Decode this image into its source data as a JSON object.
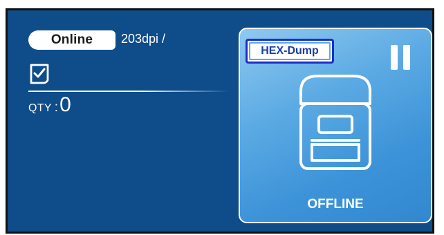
{
  "status": {
    "connection": "Online",
    "resolution": "203dpi /"
  },
  "quantity": {
    "label": "QTY",
    "separator": ":",
    "value": "0"
  },
  "printer_card": {
    "mode_badge": "HEX-Dump",
    "state": "OFFLINE",
    "pause_icon": "pause-icon",
    "printer_icon": "printer-icon"
  },
  "colors": {
    "screen_background": "#0f4c8a",
    "card_gradient_start": "#8fc9ef",
    "card_gradient_end": "#3288cf",
    "badge_border": "#1a2dcc",
    "badge_text": "#1a3ea8"
  }
}
